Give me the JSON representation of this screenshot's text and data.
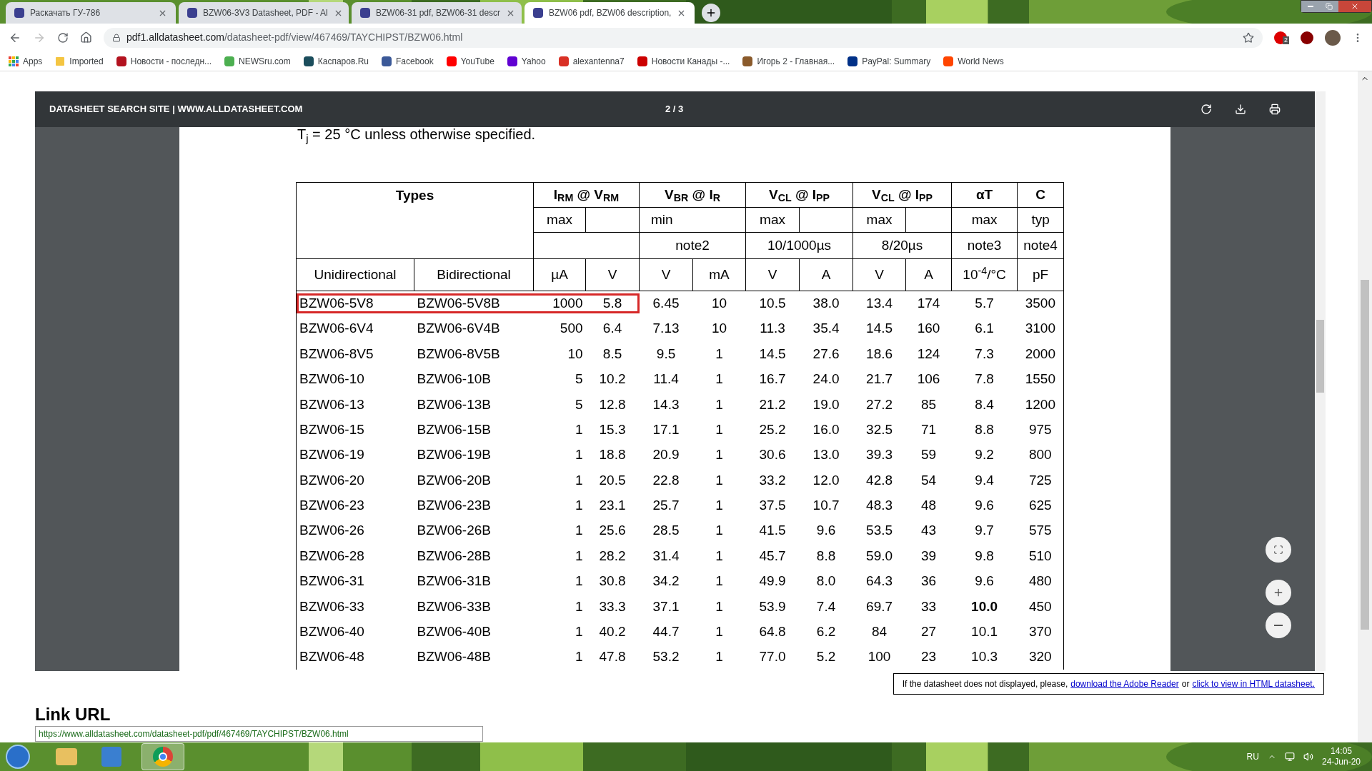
{
  "browser": {
    "tabs": [
      {
        "title": "Раскачать ГУ-786",
        "selected": false
      },
      {
        "title": "BZW06-3V3 Datasheet, PDF - Al",
        "selected": false
      },
      {
        "title": "BZW06-31 pdf, BZW06-31 descr",
        "selected": false
      },
      {
        "title": "BZW06 pdf, BZW06 description,",
        "selected": true
      }
    ],
    "address": {
      "host": "pdf1.alldatasheet.com",
      "path": "/datasheet-pdf/view/467469/TAYCHIPST/BZW06.html"
    },
    "extension_badge": "2",
    "bookmarks": [
      {
        "label": "Apps"
      },
      {
        "label": "Imported"
      },
      {
        "label": "Новости - последн..."
      },
      {
        "label": "NEWSru.com"
      },
      {
        "label": "Каспаров.Ru"
      },
      {
        "label": "Facebook"
      },
      {
        "label": "YouTube"
      },
      {
        "label": "Yahoo"
      },
      {
        "label": "alexantenna7"
      },
      {
        "label": "Новости Канады -..."
      },
      {
        "label": "Игорь 2 - Главная..."
      },
      {
        "label": "PayPal: Summary"
      },
      {
        "label": "World News"
      }
    ]
  },
  "viewer": {
    "site_title": "DATASHEET SEARCH SITE | WWW.ALLDATASHEET.COM",
    "page_indicator": "2 / 3"
  },
  "document": {
    "condition": "T$_{j}$ = 25 °C unless otherwise specified.",
    "table": {
      "types_heading": "Types",
      "groups": [
        {
          "heading": "I$_{RM}$ @ V$_{RM}$",
          "kind": "pair",
          "limit": "max"
        },
        {
          "heading": "V$_{BR}$ @ I$_{R}$",
          "kind": "pair-wide",
          "limit": "min",
          "note": "note2"
        },
        {
          "heading": "V$_{CL}$ @ I$_{PP}$",
          "kind": "pair",
          "limit": "max",
          "note": "10/1000µs"
        },
        {
          "heading": "V$_{CL}$ @ I$_{PP}$",
          "kind": "pair",
          "limit": "max",
          "note": "8/20µs"
        },
        {
          "heading": "αT",
          "kind": "single",
          "limit": "max",
          "note": "note3"
        },
        {
          "heading": "C",
          "kind": "single",
          "limit": "typ",
          "note": "note4"
        }
      ],
      "units": [
        "Unidirectional",
        "Bidirectional",
        "µA",
        "V",
        "V",
        "mA",
        "V",
        "A",
        "V",
        "A",
        "10$^{-4}$/°C",
        "pF"
      ],
      "rows": [
        {
          "uni": "BZW06-5V8",
          "bi": "BZW06-5V8B",
          "values": [
            "1000",
            "5.8",
            "6.45",
            "10",
            "10.5",
            "38.0",
            "13.4",
            "174",
            "5.7",
            "3500"
          ],
          "highlighted": true,
          "alpha_bold": false
        },
        {
          "uni": "BZW06-6V4",
          "bi": "BZW06-6V4B",
          "values": [
            "500",
            "6.4",
            "7.13",
            "10",
            "11.3",
            "35.4",
            "14.5",
            "160",
            "6.1",
            "3100"
          ],
          "highlighted": false,
          "alpha_bold": false
        },
        {
          "uni": "BZW06-8V5",
          "bi": "BZW06-8V5B",
          "values": [
            "10",
            "8.5",
            "9.5",
            "1",
            "14.5",
            "27.6",
            "18.6",
            "124",
            "7.3",
            "2000"
          ],
          "highlighted": false,
          "alpha_bold": false
        },
        {
          "uni": "BZW06-10",
          "bi": "BZW06-10B",
          "values": [
            "5",
            "10.2",
            "11.4",
            "1",
            "16.7",
            "24.0",
            "21.7",
            "106",
            "7.8",
            "1550"
          ],
          "highlighted": false,
          "alpha_bold": false
        },
        {
          "uni": "BZW06-13",
          "bi": "BZW06-13B",
          "values": [
            "5",
            "12.8",
            "14.3",
            "1",
            "21.2",
            "19.0",
            "27.2",
            "85",
            "8.4",
            "1200"
          ],
          "highlighted": false,
          "alpha_bold": false
        },
        {
          "uni": "BZW06-15",
          "bi": "BZW06-15B",
          "values": [
            "1",
            "15.3",
            "17.1",
            "1",
            "25.2",
            "16.0",
            "32.5",
            "71",
            "8.8",
            "975"
          ],
          "highlighted": false,
          "alpha_bold": false
        },
        {
          "uni": "BZW06-19",
          "bi": "BZW06-19B",
          "values": [
            "1",
            "18.8",
            "20.9",
            "1",
            "30.6",
            "13.0",
            "39.3",
            "59",
            "9.2",
            "800"
          ],
          "highlighted": false,
          "alpha_bold": false
        },
        {
          "uni": "BZW06-20",
          "bi": "BZW06-20B",
          "values": [
            "1",
            "20.5",
            "22.8",
            "1",
            "33.2",
            "12.0",
            "42.8",
            "54",
            "9.4",
            "725"
          ],
          "highlighted": false,
          "alpha_bold": false
        },
        {
          "uni": "BZW06-23",
          "bi": "BZW06-23B",
          "values": [
            "1",
            "23.1",
            "25.7",
            "1",
            "37.5",
            "10.7",
            "48.3",
            "48",
            "9.6",
            "625"
          ],
          "highlighted": false,
          "alpha_bold": false
        },
        {
          "uni": "BZW06-26",
          "bi": "BZW06-26B",
          "values": [
            "1",
            "25.6",
            "28.5",
            "1",
            "41.5",
            "9.6",
            "53.5",
            "43",
            "9.7",
            "575"
          ],
          "highlighted": false,
          "alpha_bold": false
        },
        {
          "uni": "BZW06-28",
          "bi": "BZW06-28B",
          "values": [
            "1",
            "28.2",
            "31.4",
            "1",
            "45.7",
            "8.8",
            "59.0",
            "39",
            "9.8",
            "510"
          ],
          "highlighted": false,
          "alpha_bold": false
        },
        {
          "uni": "BZW06-31",
          "bi": "BZW06-31B",
          "values": [
            "1",
            "30.8",
            "34.2",
            "1",
            "49.9",
            "8.0",
            "64.3",
            "36",
            "9.6",
            "480"
          ],
          "highlighted": false,
          "alpha_bold": false
        },
        {
          "uni": "BZW06-33",
          "bi": "BZW06-33B",
          "values": [
            "1",
            "33.3",
            "37.1",
            "1",
            "53.9",
            "7.4",
            "69.7",
            "33",
            "10.0",
            "450"
          ],
          "highlighted": false,
          "alpha_bold": true
        },
        {
          "uni": "BZW06-40",
          "bi": "BZW06-40B",
          "values": [
            "1",
            "40.2",
            "44.7",
            "1",
            "64.8",
            "6.2",
            "84",
            "27",
            "10.1",
            "370"
          ],
          "highlighted": false,
          "alpha_bold": false
        },
        {
          "uni": "BZW06-48",
          "bi": "BZW06-48B",
          "values": [
            "1",
            "47.8",
            "53.2",
            "1",
            "77.0",
            "5.2",
            "100",
            "23",
            "10.3",
            "320"
          ],
          "highlighted": false,
          "alpha_bold": false
        }
      ]
    }
  },
  "notice": {
    "text": "If the datasheet does not displayed, please,",
    "link_1": "download the Adobe Reader",
    "joiner": "or",
    "link_2": "click to view in HTML datasheet."
  },
  "link_section": {
    "heading": "Link URL",
    "url": "https://www.alldatasheet.com/datasheet-pdf/pdf/467469/TAYCHIPST/BZW06.html"
  },
  "taskbar": {
    "language": "RU",
    "time": "14:05",
    "date": "24-Jun-20"
  }
}
